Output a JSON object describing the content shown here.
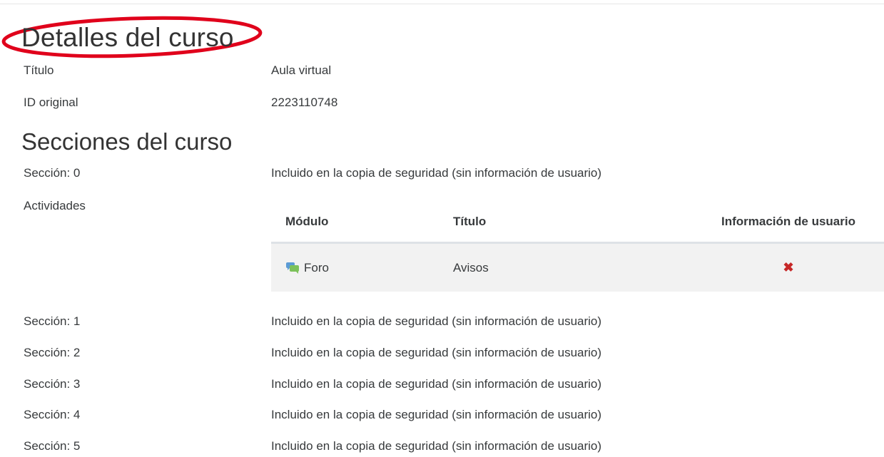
{
  "details": {
    "heading": "Detalles del curso",
    "title_label": "Título",
    "title_value": "Aula virtual",
    "id_label": "ID original",
    "id_value": "2223110748"
  },
  "sections_heading": "Secciones del curso",
  "sections": [
    {
      "label": "Sección: 0",
      "status": "Incluido en la copia de seguridad (sin información de usuario)"
    },
    {
      "label": "Sección: 1",
      "status": "Incluido en la copia de seguridad (sin información de usuario)"
    },
    {
      "label": "Sección: 2",
      "status": "Incluido en la copia de seguridad (sin información de usuario)"
    },
    {
      "label": "Sección: 3",
      "status": "Incluido en la copia de seguridad (sin información de usuario)"
    },
    {
      "label": "Sección: 4",
      "status": "Incluido en la copia de seguridad (sin información de usuario)"
    },
    {
      "label": "Sección: 5",
      "status": "Incluido en la copia de seguridad (sin información de usuario)"
    }
  ],
  "activities": {
    "label": "Actividades",
    "columns": [
      "Módulo",
      "Título",
      "Información de usuario"
    ],
    "rows": [
      {
        "module": "Foro",
        "module_icon": "forum-icon",
        "title": "Avisos",
        "user_info": "✖",
        "user_info_icon": "cross-icon"
      }
    ]
  },
  "colors": {
    "annotation_circle": "#e0001b",
    "cross": "#c62828",
    "forum_icon": "#7cc15a"
  }
}
